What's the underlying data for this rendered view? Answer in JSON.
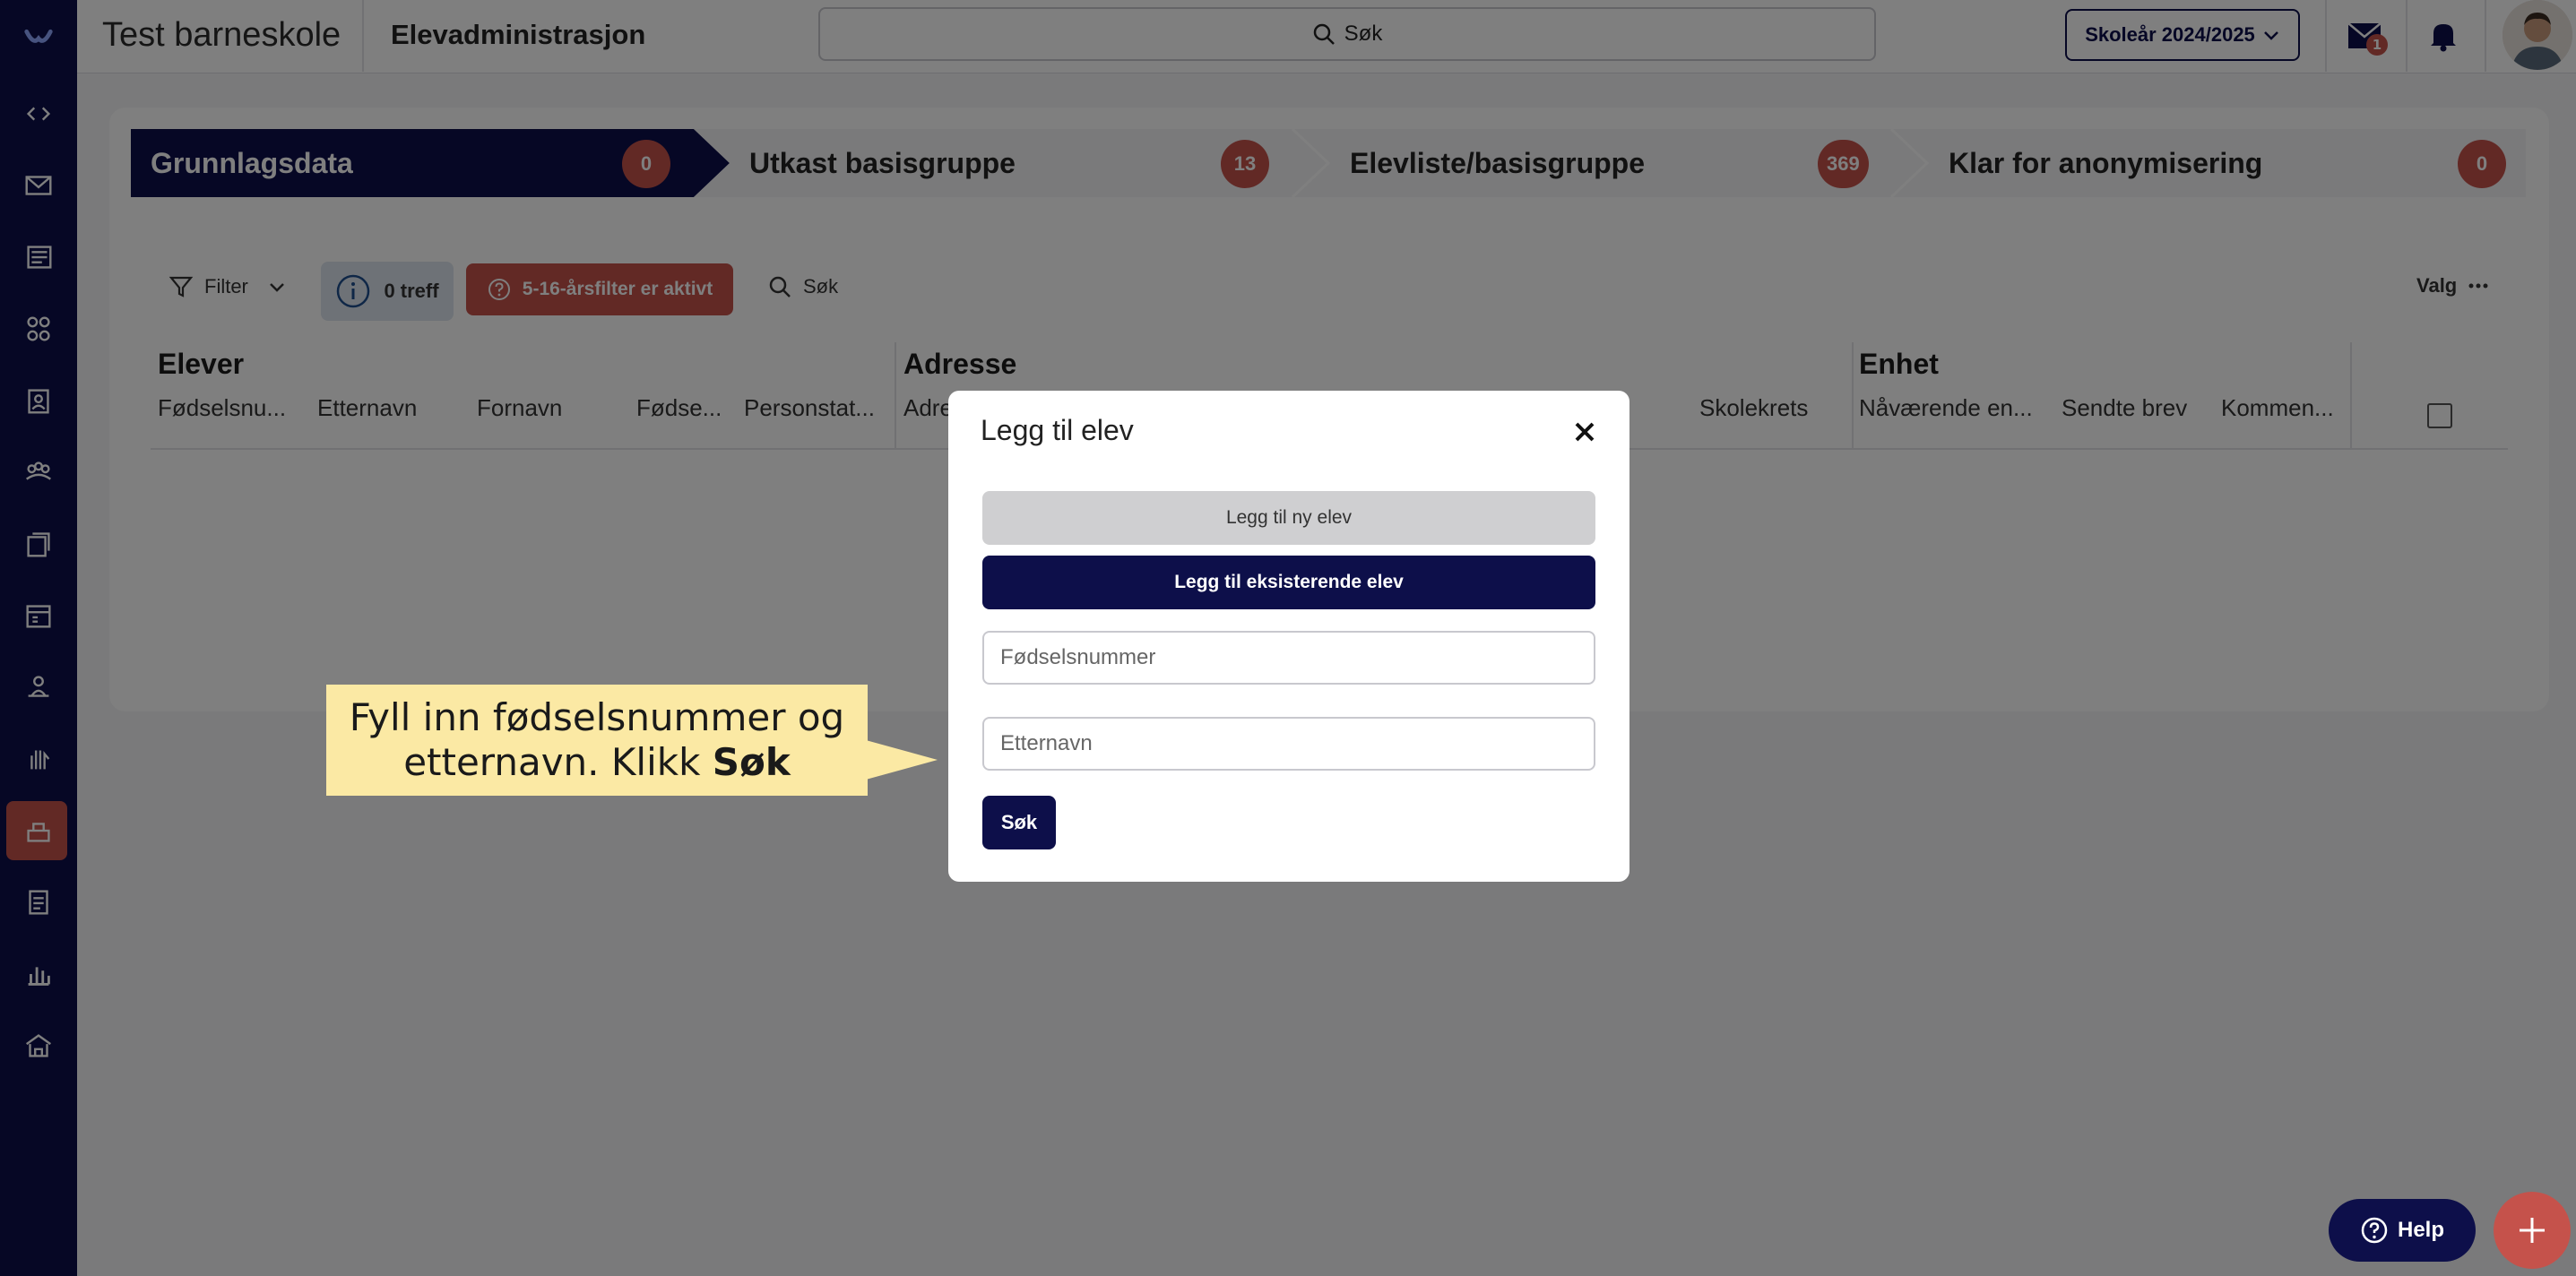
{
  "header": {
    "school_name": "Test barneskole",
    "module_name": "Elevadministrasjon",
    "search_label": "Søk",
    "year_label": "Skoleår 2024/2025",
    "mail_badge": "1"
  },
  "steps": [
    {
      "label": "Grunnlagsdata",
      "count": "0"
    },
    {
      "label": "Utkast basisgruppe",
      "count": "13"
    },
    {
      "label": "Elevliste/basisgruppe",
      "count": "369"
    },
    {
      "label": "Klar for anonymisering",
      "count": "0"
    }
  ],
  "toolbar": {
    "filter_label": "Filter",
    "treff_label": "0 treff",
    "age_filter_label": "5-16-årsfilter er aktivt",
    "search_label": "Søk",
    "valg_label": "Valg"
  },
  "table": {
    "groups": [
      "Elever",
      "Adresse",
      "Enhet"
    ],
    "columns": {
      "fodselsnummer": "Fødselsnu...",
      "etternavn": "Etternavn",
      "fornavn": "Fornavn",
      "fodsel": "Fødse...",
      "personstatus": "Personstat...",
      "adresse": "Adre",
      "skolekrets": "Skolekrets",
      "navaerende": "Nåværende en...",
      "sendte_brev": "Sendte brev",
      "kommentar": "Kommen..."
    }
  },
  "modal": {
    "title": "Legg til elev",
    "btn_new": "Legg til ny elev",
    "btn_existing": "Legg til eksisterende elev",
    "fodselsnummer_placeholder": "Fødselsnummer",
    "etternavn_placeholder": "Etternavn",
    "search_button": "Søk"
  },
  "callout": {
    "line1": "Fyll inn fødselsnummer og",
    "line2_prefix": "etternavn. Klikk ",
    "line2_bold": "Søk"
  },
  "help_label": "Help",
  "colors": {
    "navy": "#0d0f4a",
    "accent_red": "#c5524b",
    "callout_yellow": "#fbe9a4"
  }
}
